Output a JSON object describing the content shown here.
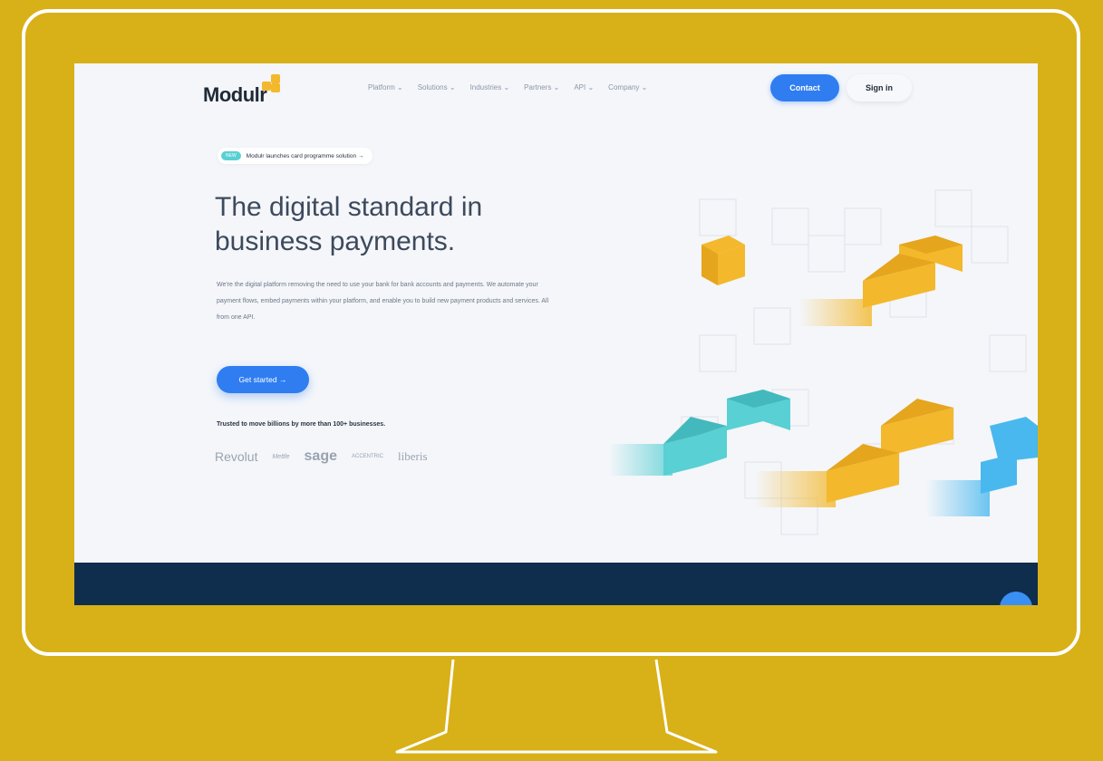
{
  "nav": {
    "logo": "Modulr",
    "menu": [
      "Platform ⌄",
      "Solutions ⌄",
      "Industries ⌄",
      "Partners ⌄",
      "API ⌄",
      "Company ⌄"
    ],
    "contact_label": "Contact",
    "signin_label": "Sign in"
  },
  "announcement": {
    "badge": "NEW",
    "text": "Modulr launches card programme solution →"
  },
  "hero": {
    "headline": "The digital standard in business payments.",
    "description": "We're the digital platform removing the need to use your bank for bank accounts and payments. We automate your payment flows, embed payments within your platform, and enable you to build new payment products and services. All from one API.",
    "cta_label": "Get started →"
  },
  "trusted": {
    "text": "Trusted to move billions by more than 100+ businesses.",
    "logos": [
      "Revolut",
      "Mettle",
      "sage",
      "ACCENTRIC",
      "liberis"
    ]
  },
  "colors": {
    "frame": "#d8b018",
    "accent": "#2f7df1",
    "teal": "#59d0d3",
    "orange": "#f3b82c",
    "navy": "#0f2d4d"
  }
}
